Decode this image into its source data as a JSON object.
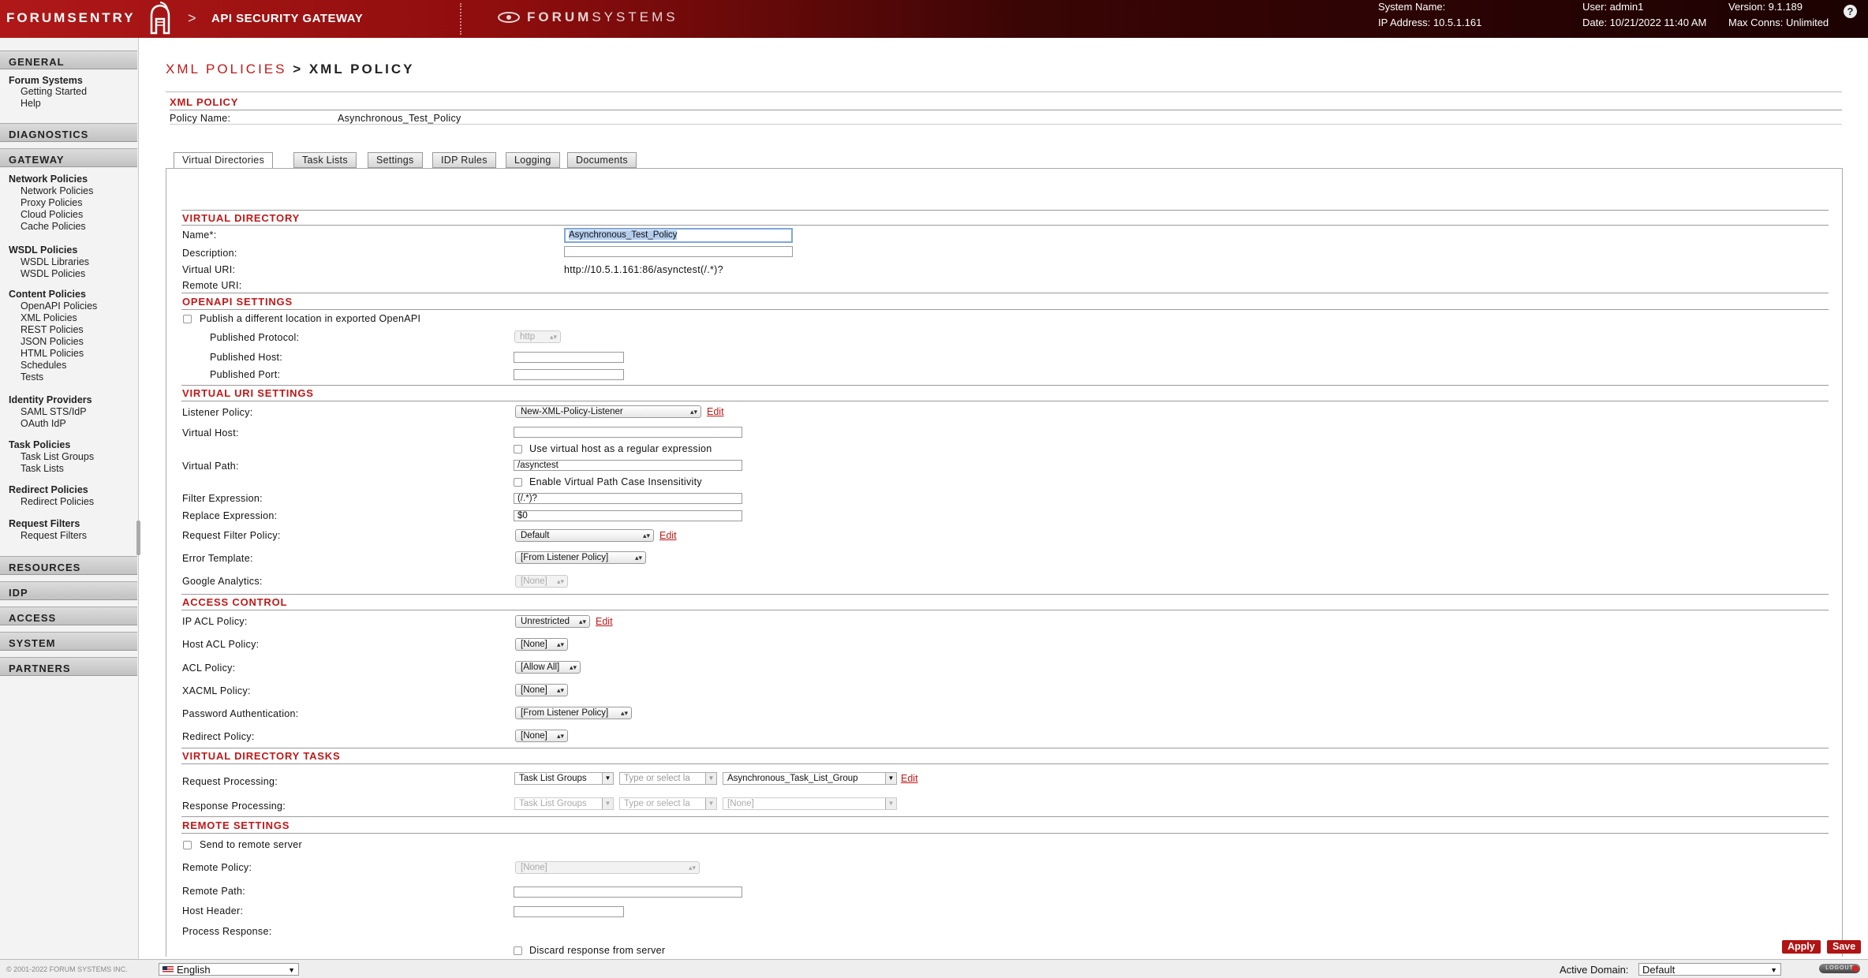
{
  "header": {
    "brand": "FORUMSENTRY",
    "separator": ">",
    "title": "API SECURITY GATEWAY",
    "vendor_logo_a": "FORUM",
    "vendor_logo_b": "SYSTEMS",
    "system_name_label": "System Name:",
    "ip_address": "IP Address: 10.5.1.161",
    "user": "User: admin1",
    "date": "Date: 10/21/2022 11:40 AM",
    "version": "Version: 9.1.189",
    "max_conns": "Max Conns: Unlimited",
    "help_icon_glyph": "?"
  },
  "sidebar": {
    "general": "GENERAL",
    "forum_systems": "Forum Systems",
    "getting_started": "Getting Started",
    "help": "Help",
    "diagnostics": "DIAGNOSTICS",
    "gateway": "GATEWAY",
    "network_policies_group": "Network Policies",
    "network_policies": "Network Policies",
    "proxy_policies": "Proxy Policies",
    "cloud_policies": "Cloud Policies",
    "cache_policies": "Cache Policies",
    "wsdl_policies_group": "WSDL Policies",
    "wsdl_libraries": "WSDL Libraries",
    "wsdl_policies": "WSDL Policies",
    "content_policies_group": "Content Policies",
    "openapi_policies": "OpenAPI Policies",
    "xml_policies": "XML Policies",
    "rest_policies": "REST Policies",
    "json_policies": "JSON Policies",
    "html_policies": "HTML Policies",
    "schedules": "Schedules",
    "tests": "Tests",
    "identity_providers_group": "Identity Providers",
    "saml_sts_idp": "SAML STS/IdP",
    "oauth_idp": "OAuth IdP",
    "task_policies_group": "Task Policies",
    "task_list_groups": "Task List Groups",
    "task_lists": "Task Lists",
    "redirect_policies_group": "Redirect Policies",
    "redirect_policies": "Redirect Policies",
    "request_filters_group": "Request Filters",
    "request_filters": "Request Filters",
    "resources": "RESOURCES",
    "idp": "IDP",
    "access": "ACCESS",
    "system": "SYSTEM",
    "partners": "PARTNERS"
  },
  "main": {
    "crumb_parent": "XML POLICIES",
    "crumb_sep": " > ",
    "crumb_current": "XML POLICY",
    "section_xml_policy": "XML POLICY",
    "policy_name_label": "Policy Name:",
    "policy_name_value": "Asynchronous_Test_Policy",
    "tabs": [
      "Virtual Directories",
      "Task Lists",
      "Settings",
      "IDP Rules",
      "Logging",
      "Documents"
    ],
    "virtual_directory": {
      "heading": "VIRTUAL DIRECTORY",
      "name_label": "Name*:",
      "name_value": "Asynchronous_Test_Policy",
      "description_label": "Description:",
      "description_value": "",
      "virtual_uri_label": "Virtual URI:",
      "virtual_uri_value": "http://10.5.1.161:86/asynctest(/.*)?",
      "remote_uri_label": "Remote URI:"
    },
    "openapi": {
      "heading": "OPENAPI SETTINGS",
      "publish_label": "Publish a different location in exported OpenAPI",
      "protocol_label": "Published Protocol:",
      "protocol_value": "http",
      "host_label": "Published Host:",
      "port_label": "Published Port:"
    },
    "virtual_uri": {
      "heading": "VIRTUAL URI SETTINGS",
      "listener_label": "Listener Policy:",
      "listener_value": "New-XML-Policy-Listener",
      "edit": "Edit",
      "virtual_host_label": "Virtual Host:",
      "virtual_host_value": "",
      "regex_label": "Use virtual host as a regular expression",
      "virtual_path_label": "Virtual Path:",
      "virtual_path_value": "/asynctest",
      "case_label": "Enable Virtual Path Case Insensitivity",
      "filter_label": "Filter Expression:",
      "filter_value": "(/.*)?",
      "replace_label": "Replace Expression:",
      "replace_value": "$0",
      "request_filter_label": "Request Filter Policy:",
      "request_filter_value": "Default",
      "error_template_label": "Error Template:",
      "error_template_value": "[From Listener Policy]",
      "ga_label": "Google Analytics:",
      "ga_value": "[None]"
    },
    "access_control": {
      "heading": "ACCESS CONTROL",
      "ip_acl_label": "IP ACL Policy:",
      "ip_acl_value": "Unrestricted",
      "host_acl_label": "Host ACL Policy:",
      "host_acl_value": "[None]",
      "acl_label": "ACL Policy:",
      "acl_value": "[Allow All]",
      "xacml_label": "XACML Policy:",
      "xacml_value": "[None]",
      "password_label": "Password Authentication:",
      "password_value": "[From Listener Policy]",
      "redirect_label": "Redirect Policy:",
      "redirect_value": "[None]"
    },
    "tasks": {
      "heading": "VIRTUAL DIRECTORY TASKS",
      "request_label": "Request Processing:",
      "response_label": "Response Processing:",
      "type_value": "Task List Groups",
      "type_placeholder": "Type or select la",
      "request_group_value": "Asynchronous_Task_List_Group",
      "response_group_value": "[None]"
    },
    "remote": {
      "heading": "REMOTE SETTINGS",
      "send_label": "Send to remote server",
      "policy_label": "Remote Policy:",
      "policy_value": "[None]",
      "path_label": "Remote Path:",
      "host_header_label": "Host Header:",
      "process_label": "Process Response:",
      "discard_label": "Discard response from server"
    },
    "apply": "Apply",
    "save": "Save"
  },
  "footer": {
    "copyright": "© 2001-2022 FORUM SYSTEMS INC.",
    "language": "English",
    "active_domain_label": "Active Domain:",
    "active_domain": "Default",
    "logout": "LOGOUT"
  },
  "colors": {
    "accent_red": "#c01818",
    "header_dark": "#1c0202"
  }
}
